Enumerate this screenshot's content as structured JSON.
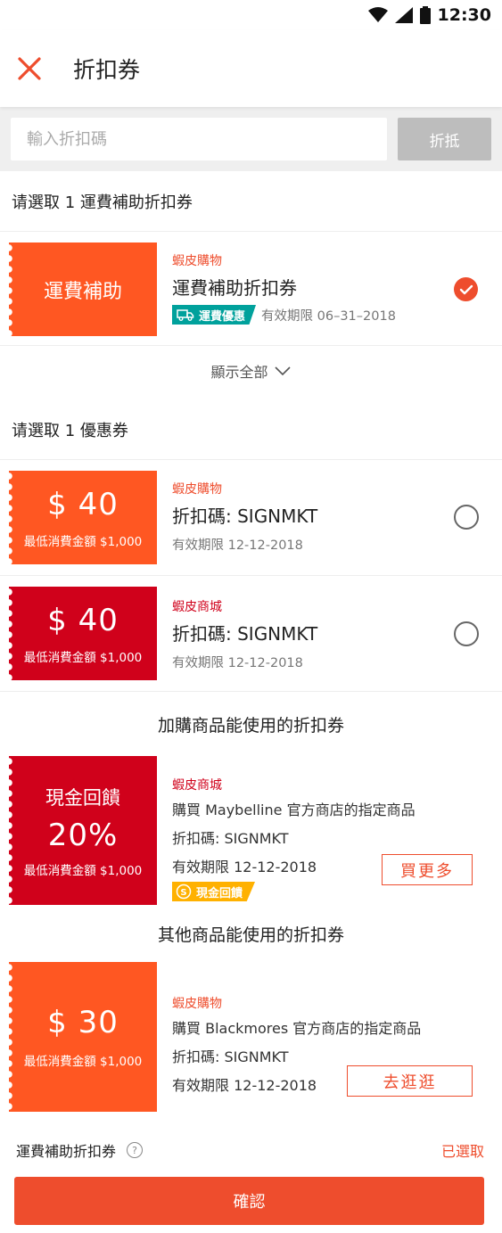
{
  "status_bar": {
    "time": "12:30"
  },
  "header": {
    "title": "折扣券"
  },
  "code_entry": {
    "placeholder": "輸入折扣碼",
    "button_label": "折抵"
  },
  "shipping_section": {
    "title": "请選取 1 運費補助折扣券",
    "voucher": {
      "stub_label": "運費補助",
      "shop": "蝦皮購物",
      "name": "運費補助折扣券",
      "tag": "運費優惠",
      "expiry": "有效期限 06–31–2018",
      "selected": true
    },
    "show_all": "顯示全部"
  },
  "discount_section": {
    "title": "请選取 1 優惠券",
    "vouchers": [
      {
        "amount": "$ 40",
        "min_spend": "最低消費金額 $1,000",
        "shop": "蝦皮購物",
        "code": "折扣碼: SIGNMKT",
        "expiry": "有效期限 12-12-2018",
        "color": "#ff5722"
      },
      {
        "amount": "$ 40",
        "min_spend": "最低消費金額 $1,000",
        "shop": "蝦皮商城",
        "code": "折扣碼: SIGNMKT",
        "expiry": "有效期限 12-12-2018",
        "color": "#d0011b"
      }
    ]
  },
  "addon_section": {
    "title": "加購商品能使用的折扣券",
    "voucher": {
      "stub_title": "現金回饋",
      "percent": "20%",
      "min_spend": "最低消費金額 $1,000",
      "shop": "蝦皮商城",
      "description": "購買 Maybelline 官方商店的指定商品",
      "code": "折扣碼: SIGNMKT",
      "expiry": "有效期限 12-12-2018",
      "tag": "現金回饋",
      "button_label": "買更多"
    }
  },
  "other_section": {
    "title": "其他商品能使用的折扣券",
    "voucher": {
      "amount": "$ 30",
      "min_spend": "最低消費金額 $1,000",
      "shop": "蝦皮購物",
      "description": "購買 Blackmores 官方商店的指定商品",
      "code": "折扣碼: SIGNMKT",
      "expiry": "有效期限 12-12-2018",
      "button_label": "去逛逛"
    }
  },
  "footer": {
    "label": "運費補助折扣券",
    "help_glyph": "?",
    "state": "已選取",
    "confirm_label": "確認"
  },
  "colors": {
    "brand": "#ee4d2d",
    "mall_red": "#d0011b",
    "shipping_teal": "#00a19c",
    "cashback_yellow": "#ffb100"
  }
}
